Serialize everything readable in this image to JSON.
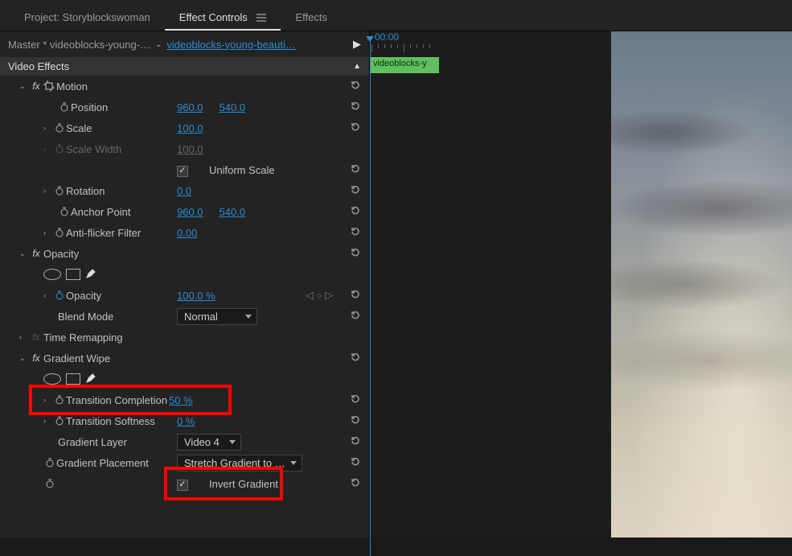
{
  "tabs": {
    "project": "Project: Storyblockswoman",
    "effect_controls": "Effect Controls",
    "effects": "Effects"
  },
  "master": {
    "prefix": "Master * videoblocks-young-…",
    "clip": "videoblocks-young-beauti…"
  },
  "section_video_effects": "Video Effects",
  "motion": {
    "label": "Motion",
    "position": {
      "label": "Position",
      "x": "960.0",
      "y": "540.0"
    },
    "scale": {
      "label": "Scale",
      "value": "100.0"
    },
    "scale_width": {
      "label": "Scale Width",
      "value": "100.0"
    },
    "uniform": "Uniform Scale",
    "rotation": {
      "label": "Rotation",
      "value": "0.0"
    },
    "anchor": {
      "label": "Anchor Point",
      "x": "960.0",
      "y": "540.0"
    },
    "antiflicker": {
      "label": "Anti-flicker Filter",
      "value": "0.00"
    }
  },
  "opacity": {
    "label": "Opacity",
    "opacity": {
      "label": "Opacity",
      "value": "100.0 %"
    },
    "blend": {
      "label": "Blend Mode",
      "value": "Normal"
    }
  },
  "time_remap": "Time Remapping",
  "gradient_wipe": {
    "label": "Gradient Wipe",
    "transition_completion": {
      "label": "Transition Completion",
      "value": "50 %"
    },
    "transition_softness": {
      "label": "Transition Softness",
      "value": "0 %"
    },
    "gradient_layer": {
      "label": "Gradient Layer",
      "value": "Video 4"
    },
    "gradient_placement": {
      "label": "Gradient Placement",
      "value": "Stretch Gradient to …"
    },
    "invert": "Invert Gradient"
  },
  "timeline": {
    "timecode": "00:00",
    "clip_label": "videoblocks-y"
  }
}
